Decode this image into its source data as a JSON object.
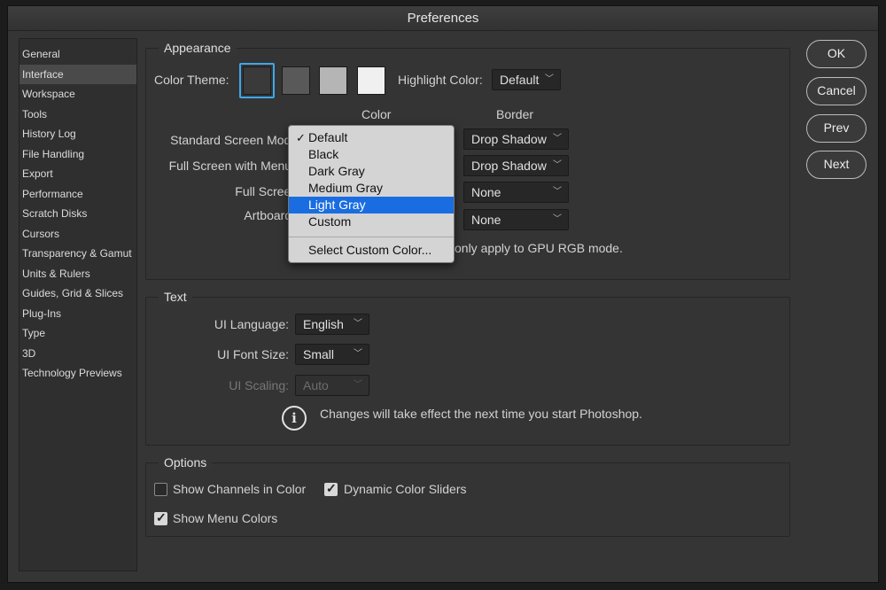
{
  "window": {
    "title": "Preferences"
  },
  "sidebar": {
    "items": [
      {
        "label": "General"
      },
      {
        "label": "Interface"
      },
      {
        "label": "Workspace"
      },
      {
        "label": "Tools"
      },
      {
        "label": "History Log"
      },
      {
        "label": "File Handling"
      },
      {
        "label": "Export"
      },
      {
        "label": "Performance"
      },
      {
        "label": "Scratch Disks"
      },
      {
        "label": "Cursors"
      },
      {
        "label": "Transparency & Gamut"
      },
      {
        "label": "Units & Rulers"
      },
      {
        "label": "Guides, Grid & Slices"
      },
      {
        "label": "Plug-Ins"
      },
      {
        "label": "Type"
      },
      {
        "label": "3D"
      },
      {
        "label": "Technology Previews"
      }
    ],
    "active_index": 1
  },
  "appearance": {
    "title": "Appearance",
    "color_theme_label": "Color Theme:",
    "themes": [
      {
        "name": "darkest",
        "color": "#3a3a3a",
        "selected": true
      },
      {
        "name": "dark",
        "color": "#595959",
        "selected": false
      },
      {
        "name": "medium",
        "color": "#b5b5b5",
        "selected": false
      },
      {
        "name": "light",
        "color": "#f0f0f0",
        "selected": false
      }
    ],
    "highlight_label": "Highlight Color:",
    "highlight_value": "Default",
    "col_color": "Color",
    "col_border": "Border",
    "rows": [
      {
        "label": "Standard Screen Mode:",
        "border": "Drop Shadow"
      },
      {
        "label": "Full Screen with Menus:",
        "border": "Drop Shadow"
      },
      {
        "label": "Full Screen:",
        "border": "None"
      },
      {
        "label": "Artboards:",
        "border": "None"
      }
    ],
    "note": "only apply to GPU RGB mode.",
    "accent_color": "#3ea7ea"
  },
  "color_menu": {
    "items": [
      "Default",
      "Black",
      "Dark Gray",
      "Medium Gray",
      "Light Gray",
      "Custom"
    ],
    "checked": "Default",
    "highlighted": "Light Gray",
    "custom_item": "Select Custom Color...",
    "highlight_color": "#1a6de0"
  },
  "text": {
    "title": "Text",
    "ui_language_label": "UI Language:",
    "ui_language_value": "English",
    "ui_font_size_label": "UI Font Size:",
    "ui_font_size_value": "Small",
    "ui_scaling_label": "UI Scaling:",
    "ui_scaling_value": "Auto",
    "info_icon": "info-icon",
    "info_text": "Changes will take effect the next time you start Photoshop."
  },
  "options": {
    "title": "Options",
    "show_channels_label": "Show Channels in Color",
    "show_channels_checked": false,
    "dynamic_sliders_label": "Dynamic Color Sliders",
    "dynamic_sliders_checked": true,
    "show_menu_colors_label": "Show Menu Colors",
    "show_menu_colors_checked": true
  },
  "buttons": {
    "ok": "OK",
    "cancel": "Cancel",
    "prev": "Prev",
    "next": "Next"
  }
}
